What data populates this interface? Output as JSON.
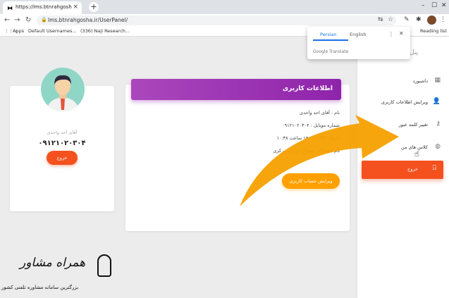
{
  "browser": {
    "tab_title": "https://lms.btnrahgosha.ir/UserPanel/",
    "tab_close": "×",
    "new_tab": "+",
    "url": "lms.btnrahgosha.ir/UserPanel/",
    "bookmarks": [
      "Apps",
      "Default Usernames...",
      "(336) Naji Research..."
    ],
    "reading_list": "Reading list"
  },
  "translate_popup": {
    "active_lang": "Persian",
    "other_lang": "English",
    "footer": "Google Translate"
  },
  "profile_card": {
    "name": "آقای احد واحدی",
    "phone": "۰۹۱۲۱۰۲۰۳۰۴",
    "logout": "خروج"
  },
  "info_card": {
    "title": "اطلاعات کاربری",
    "lines": [
      "نام : آقای احد واحدی",
      "شماره موبایل : ۰۹۱۲۱۰۲۰۳۰۴",
      "تاریخ : ۱۴۰۰/۱۰/۲۳ ساعت ۱۰:۳۸",
      "نام دانشگاه : تهران / تهران مرکزی"
    ],
    "edit_button": "ویرایش حساب کاربری"
  },
  "sidebar": {
    "top_label": "پنل",
    "items": [
      {
        "label": "داشبورد",
        "icon": "dashboard-icon"
      },
      {
        "label": "ویرایش اطلاعات کاربری",
        "icon": "user-icon"
      },
      {
        "label": "تغییر کلمه عبور",
        "icon": "key-icon"
      },
      {
        "label": "کلاس های من",
        "icon": "globe-icon"
      }
    ],
    "logout": "خروج"
  },
  "watermark": {
    "brand": "همراه مشاور",
    "tagline": "بزرگترین سامانه مشاوره تلفنی کشور"
  },
  "colors": {
    "accent_purple": "#9c27b0",
    "accent_orange": "#ffa000",
    "accent_red": "#f4511e",
    "arrow": "#f5a000"
  }
}
